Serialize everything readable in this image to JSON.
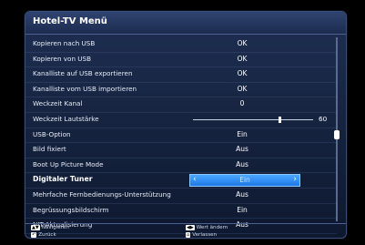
{
  "title": "Hotel-TV Menü",
  "items": [
    {
      "label": "Kopieren nach USB",
      "value": "OK"
    },
    {
      "label": "Kopieren von USB",
      "value": "OK"
    },
    {
      "label": "Kanalliste auf USB exportieren",
      "value": "OK"
    },
    {
      "label": "Kanalliste vom USB importieren",
      "value": "OK"
    },
    {
      "label": "Weckzeit Kanal",
      "value": "0"
    },
    {
      "label": "Weckzeit Lautstärke",
      "slider_value": "60",
      "slider_level_percent": 72
    },
    {
      "label": "USB-Option",
      "value": "Ein"
    },
    {
      "label": "Bild fixiert",
      "value": "Aus"
    },
    {
      "label": "Boot Up Picture Mode",
      "value": "Aus"
    },
    {
      "label": "Digitaler Tuner",
      "value": "Ein",
      "selected": true
    },
    {
      "label": "Mehrfache Fernbedienungs-Unterstützung",
      "value": "Aus"
    },
    {
      "label": "Begrüssungsbildschirm",
      "value": "Ein"
    },
    {
      "label": "NIT-Aktualisierung",
      "value": "Aus"
    }
  ],
  "footer": {
    "navigate": "Navigieren",
    "back": "Zurück",
    "change_value": "Wert ändern",
    "exit": "Verlassen"
  },
  "colors": {
    "menu_background": "#14213c",
    "selection": "#2a8cf2",
    "text": "#ffffff"
  }
}
